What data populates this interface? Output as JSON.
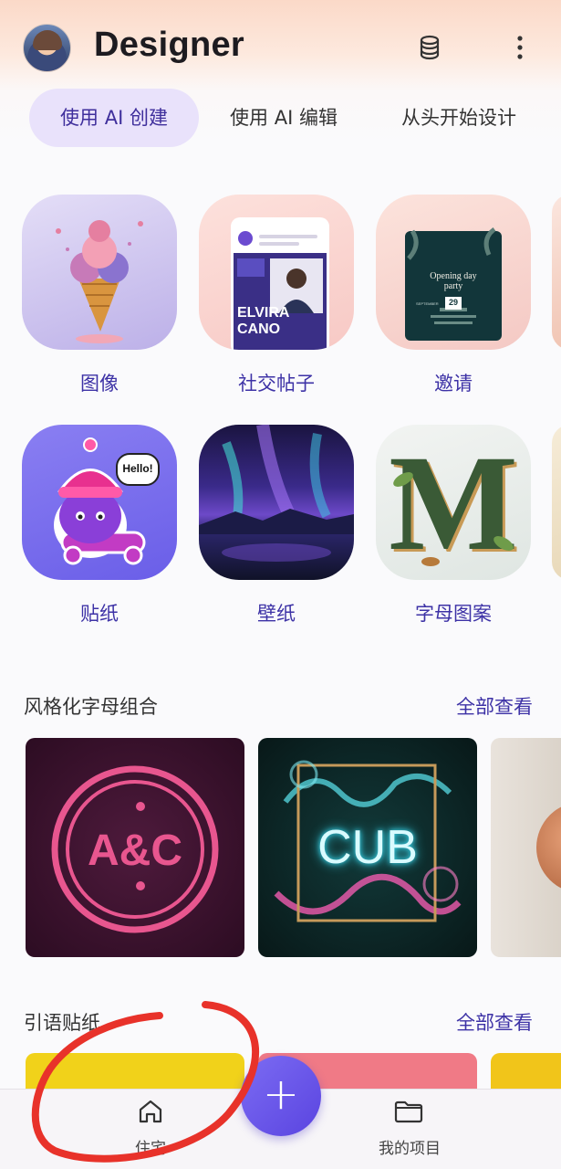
{
  "header": {
    "app_title": "Designer"
  },
  "tabs": [
    {
      "label": "使用 AI 创建",
      "active": true
    },
    {
      "label": "使用 AI 编辑",
      "active": false
    },
    {
      "label": "从头开始设计",
      "active": false
    }
  ],
  "categories": [
    {
      "label": "图像"
    },
    {
      "label": "社交帖子",
      "thumb_text": {
        "name": "ELVIRA CANO"
      }
    },
    {
      "label": "邀请",
      "thumb_text": {
        "title": "Opening day party",
        "month": "SEPTEMBER",
        "day": "29"
      }
    },
    {
      "label": "贴纸",
      "thumb_text": {
        "bubble": "Hello!"
      }
    },
    {
      "label": "壁纸"
    },
    {
      "label": "字母图案",
      "thumb_text": {
        "letter": "M"
      }
    }
  ],
  "sections": [
    {
      "title": "风格化字母组合",
      "see_all": "全部查看",
      "cards": [
        {
          "text": "A&C"
        },
        {
          "text": "CUB"
        }
      ]
    },
    {
      "title": "引语贴纸",
      "see_all": "全部查看"
    }
  ],
  "bottom_nav": {
    "home_label": "住宅",
    "projects_label": "我的项目",
    "fab_label": "+"
  },
  "colors": {
    "accent": "#3d32a6",
    "tab_active_bg": "#e9e2fb",
    "fab": "#6a57ea",
    "annotation_red": "#e8322a"
  }
}
